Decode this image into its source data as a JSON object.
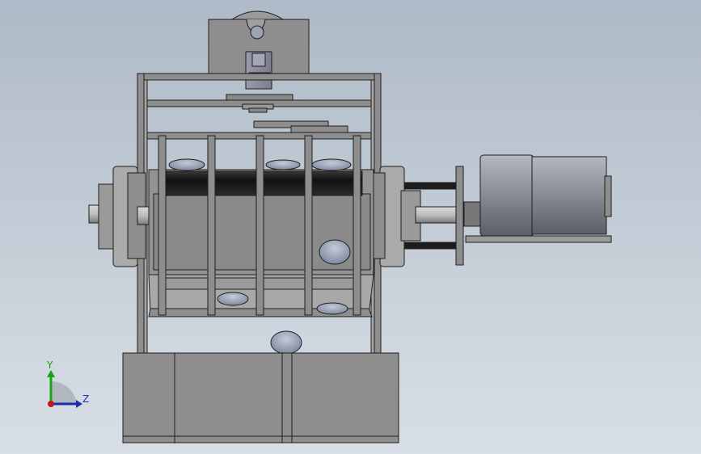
{
  "viewport": {
    "background_top": "#aebac7",
    "background_bottom": "#d9dfe6",
    "part_color": "#8e8e8e",
    "edge_color": "#1f1f1f",
    "drum_color": "#1a1a1a",
    "motor_color": "#8c8e98",
    "bean_color": "#8e97ad"
  },
  "triad": {
    "y_label": "Y",
    "z_label": "Z",
    "y_color": "#1aa01a",
    "z_color": "#1a2fb0",
    "x_color": "#c0181a"
  }
}
